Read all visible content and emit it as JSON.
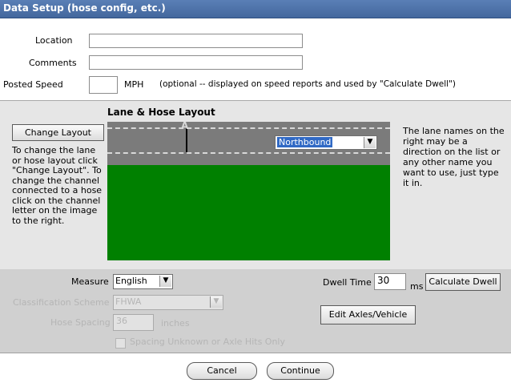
{
  "window": {
    "title": "Data Setup (hose config, etc.)"
  },
  "form": {
    "location_label": "Location",
    "location_value": "",
    "comments_label": "Comments",
    "comments_value": "",
    "posted_speed_label": "Posted Speed",
    "posted_speed_value": "",
    "speed_unit": "MPH",
    "speed_note": "(optional -- displayed on speed reports and used by \"Calculate Dwell\")"
  },
  "layout": {
    "heading": "Lane & Hose Layout",
    "change_layout_button": "Change Layout",
    "left_help": "To change the lane or hose layout click \"Change Layout\". To change the channel connected to a hose click on the channel letter on the image to the right.",
    "right_help": "The lane names on the right may be a direction on the list or any other name you want to use, just type it in.",
    "channel_letter": "A",
    "lane_direction": "Northbound",
    "road_color": "#7b7b7b",
    "grass_color": "#008000"
  },
  "settings": {
    "measure_label": "Measure",
    "measure_value": "English",
    "scheme_label": "Classification Scheme",
    "scheme_value": "FHWA",
    "hose_spacing_label": "Hose Spacing",
    "hose_spacing_value": "36",
    "hose_spacing_unit": "inches",
    "checkbox_label": "Spacing Unknown or Axle Hits Only",
    "dwell_label": "Dwell Time",
    "dwell_value": "30",
    "dwell_unit": "ms",
    "calc_dwell_button": "Calculate Dwell",
    "edit_axles_button": "Edit Axles/Vehicle"
  },
  "footer": {
    "cancel": "Cancel",
    "continue": "Continue"
  }
}
